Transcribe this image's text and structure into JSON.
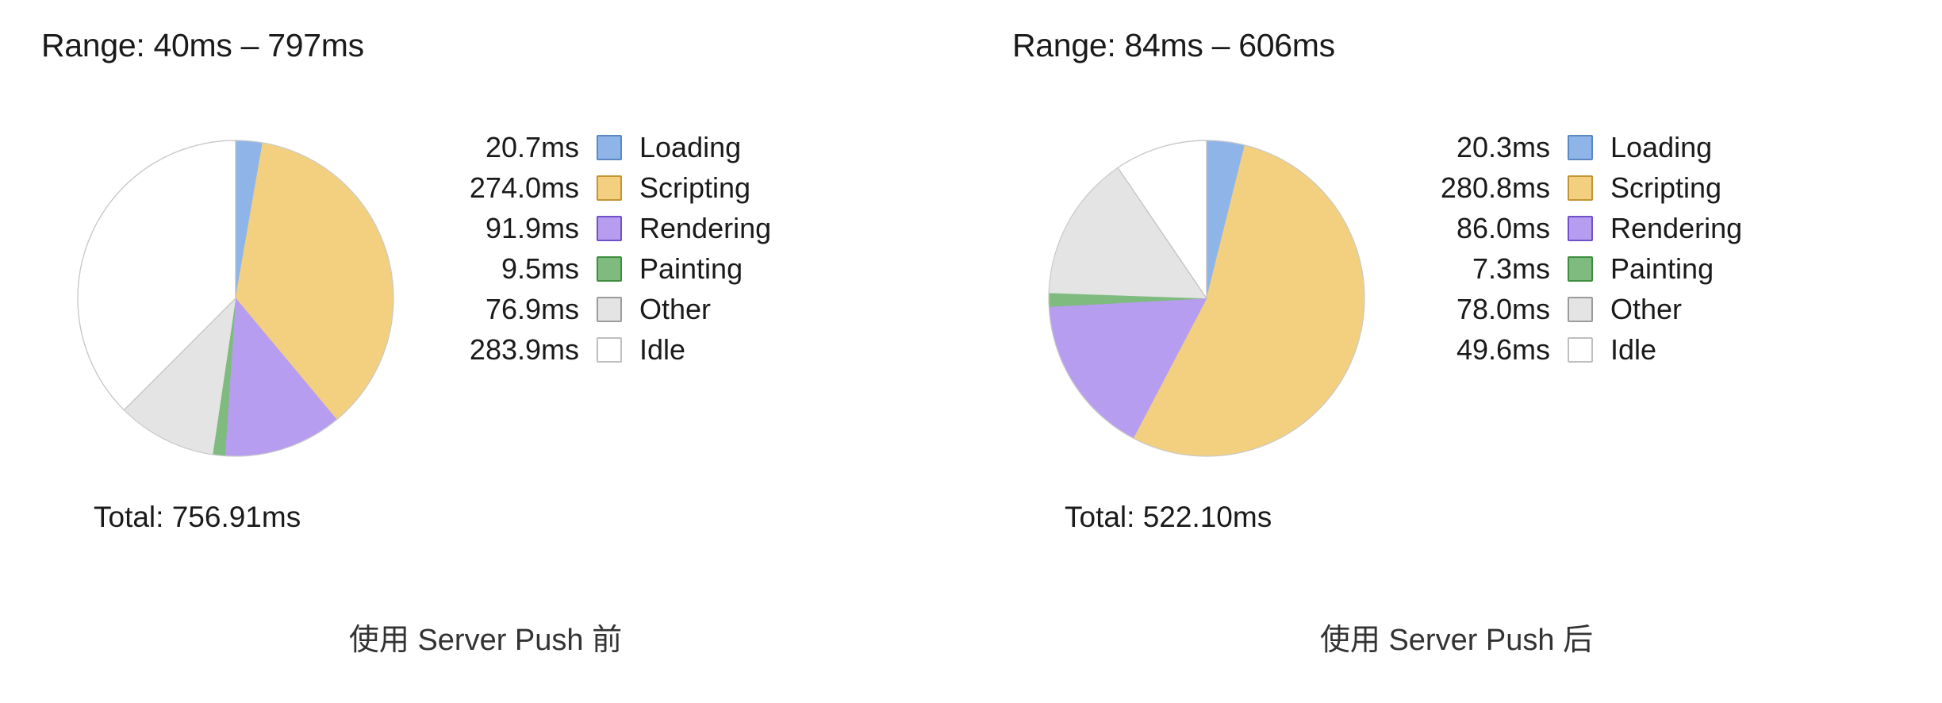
{
  "palette": {
    "loading_fill": "#8fb5e8",
    "loading_stroke": "#5b87c4",
    "scripting_fill": "#f3d07f",
    "scripting_stroke": "#c29432",
    "rendering_fill": "#b79df0",
    "rendering_stroke": "#6f51c9",
    "painting_fill": "#7fbb7f",
    "painting_stroke": "#3f8e3f",
    "other_fill": "#e4e4e4",
    "other_stroke": "#9b9b9b",
    "idle_fill": "#ffffff",
    "idle_stroke": "#bfbfbf"
  },
  "panels": [
    {
      "id": "before",
      "range_label": "Range: 40ms – 797ms",
      "total_label": "Total: 756.91ms",
      "caption": "使用 Server Push 前",
      "legend": [
        {
          "value": "20.7ms",
          "name": "Loading",
          "swatch": "loading"
        },
        {
          "value": "274.0ms",
          "name": "Scripting",
          "swatch": "scripting"
        },
        {
          "value": "91.9ms",
          "name": "Rendering",
          "swatch": "rendering"
        },
        {
          "value": "9.5ms",
          "name": "Painting",
          "swatch": "painting"
        },
        {
          "value": "76.9ms",
          "name": "Other",
          "swatch": "other"
        },
        {
          "value": "283.9ms",
          "name": "Idle",
          "swatch": "idle"
        }
      ]
    },
    {
      "id": "after",
      "range_label": "Range: 84ms – 606ms",
      "total_label": "Total: 522.10ms",
      "caption": "使用 Server Push 后",
      "legend": [
        {
          "value": "20.3ms",
          "name": "Loading",
          "swatch": "loading"
        },
        {
          "value": "280.8ms",
          "name": "Scripting",
          "swatch": "scripting"
        },
        {
          "value": "86.0ms",
          "name": "Rendering",
          "swatch": "rendering"
        },
        {
          "value": "7.3ms",
          "name": "Painting",
          "swatch": "painting"
        },
        {
          "value": "78.0ms",
          "name": "Other",
          "swatch": "other"
        },
        {
          "value": "49.6ms",
          "name": "Idle",
          "swatch": "idle"
        }
      ]
    }
  ],
  "chart_data": [
    {
      "type": "pie",
      "title": "使用 Server Push 前",
      "subtitle": "Range: 40ms – 797ms",
      "annotation": "Total: 756.91ms",
      "unit": "ms",
      "total": 756.91,
      "start_angle_deg": 0,
      "direction": "clockwise",
      "legend_position": "right",
      "categories": [
        "Loading",
        "Scripting",
        "Rendering",
        "Painting",
        "Other",
        "Idle"
      ],
      "values": [
        20.7,
        274.0,
        91.9,
        9.5,
        76.9,
        283.9
      ],
      "colors": [
        "#8fb5e8",
        "#f3d07f",
        "#b79df0",
        "#7fbb7f",
        "#e4e4e4",
        "#ffffff"
      ]
    },
    {
      "type": "pie",
      "title": "使用 Server Push 后",
      "subtitle": "Range: 84ms – 606ms",
      "annotation": "Total: 522.10ms",
      "unit": "ms",
      "total": 522.1,
      "start_angle_deg": 0,
      "direction": "clockwise",
      "legend_position": "right",
      "categories": [
        "Loading",
        "Scripting",
        "Rendering",
        "Painting",
        "Other",
        "Idle"
      ],
      "values": [
        20.3,
        280.8,
        86.0,
        7.3,
        78.0,
        49.6
      ],
      "colors": [
        "#8fb5e8",
        "#f3d07f",
        "#b79df0",
        "#7fbb7f",
        "#e4e4e4",
        "#ffffff"
      ]
    }
  ]
}
